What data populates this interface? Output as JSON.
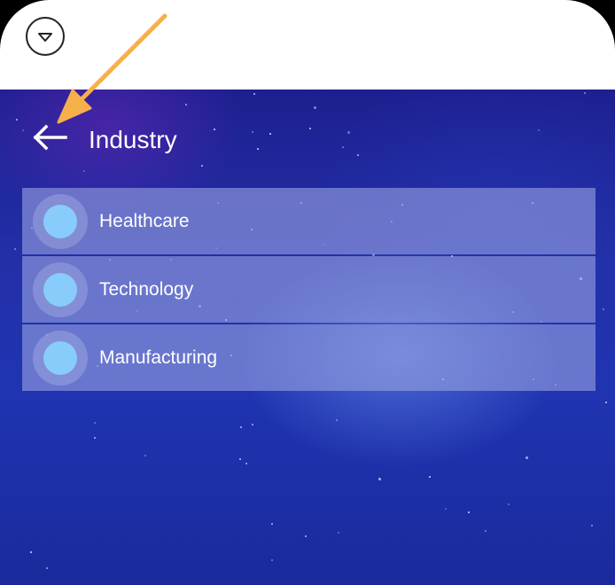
{
  "header": {
    "title": "Industry",
    "back_icon": "arrow-left-icon"
  },
  "top_bar": {
    "dropdown_icon": "chevron-down-circle-icon"
  },
  "industry_list": {
    "items": [
      {
        "label": "Healthcare",
        "selected": false
      },
      {
        "label": "Technology",
        "selected": false
      },
      {
        "label": "Manufacturing",
        "selected": false
      }
    ]
  },
  "colors": {
    "radio_dot": "#88ccfb",
    "annotation_arrow": "#f5b04a",
    "background_top": "#1d1f8f",
    "background_bottom": "#1a2a9c"
  }
}
